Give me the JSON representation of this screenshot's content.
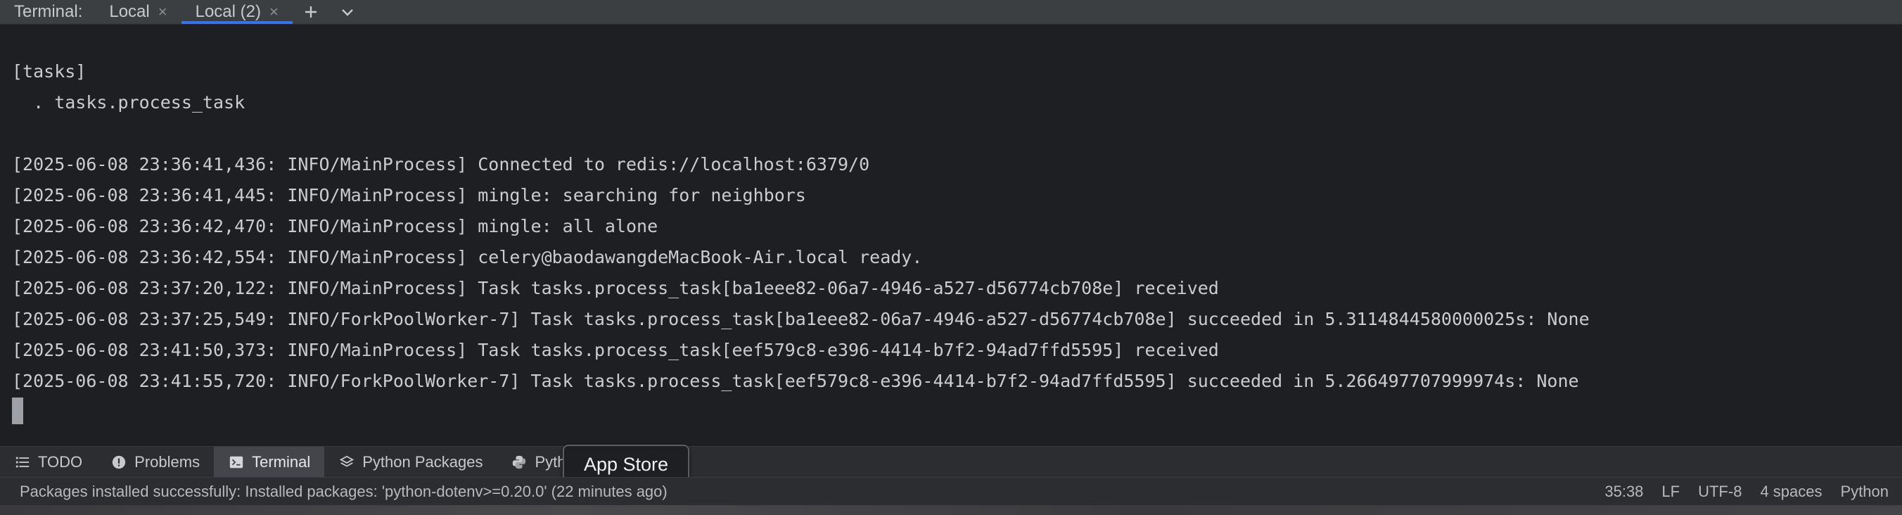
{
  "tabbar": {
    "title": "Terminal:",
    "tabs": [
      {
        "label": "Local",
        "close": "×"
      },
      {
        "label": "Local (2)",
        "close": "×"
      }
    ],
    "add_icon": "plus-icon",
    "more_icon": "chevron-down-icon"
  },
  "terminal": {
    "lines": [
      "[tasks]",
      "  . tasks.process_task",
      "[2025-06-08 23:36:41,436: INFO/MainProcess] Connected to redis://localhost:6379/0",
      "[2025-06-08 23:36:41,445: INFO/MainProcess] mingle: searching for neighbors",
      "[2025-06-08 23:36:42,470: INFO/MainProcess] mingle: all alone",
      "[2025-06-08 23:36:42,554: INFO/MainProcess] celery@baodawangdeMacBook-Air.local ready.",
      "[2025-06-08 23:37:20,122: INFO/MainProcess] Task tasks.process_task[ba1eee82-06a7-4946-a527-d56774cb708e] received",
      "[2025-06-08 23:37:25,549: INFO/ForkPoolWorker-7] Task tasks.process_task[ba1eee82-06a7-4946-a527-d56774cb708e] succeeded in 5.3114844580000025s: None",
      "[2025-06-08 23:41:50,373: INFO/MainProcess] Task tasks.process_task[eef579c8-e396-4414-b7f2-94ad7ffd5595] received",
      "[2025-06-08 23:41:55,720: INFO/ForkPoolWorker-7] Task tasks.process_task[eef579c8-e396-4414-b7f2-94ad7ffd5595] succeeded in 5.266497707999974s: None"
    ]
  },
  "toolbar": {
    "items": [
      {
        "label": "TODO",
        "icon": "list-icon"
      },
      {
        "label": "Problems",
        "icon": "alert-icon"
      },
      {
        "label": "Terminal",
        "icon": "terminal-icon",
        "active": true
      },
      {
        "label": "Python Packages",
        "icon": "layers-icon"
      },
      {
        "label": "Pyth",
        "icon": "python-icon"
      }
    ]
  },
  "tooltip": {
    "text": "App Store"
  },
  "statusbar": {
    "message": "Packages installed successfully: Installed packages: 'python-dotenv>=0.20.0' (22 minutes ago)",
    "position": "35:38",
    "line_separator": "LF",
    "encoding": "UTF-8",
    "indent": "4 spaces",
    "interpreter": "Python"
  },
  "colors": {
    "accent": "#3574f0",
    "terminal_bg": "#1e1f22",
    "chrome_bg": "#2b2d30"
  }
}
